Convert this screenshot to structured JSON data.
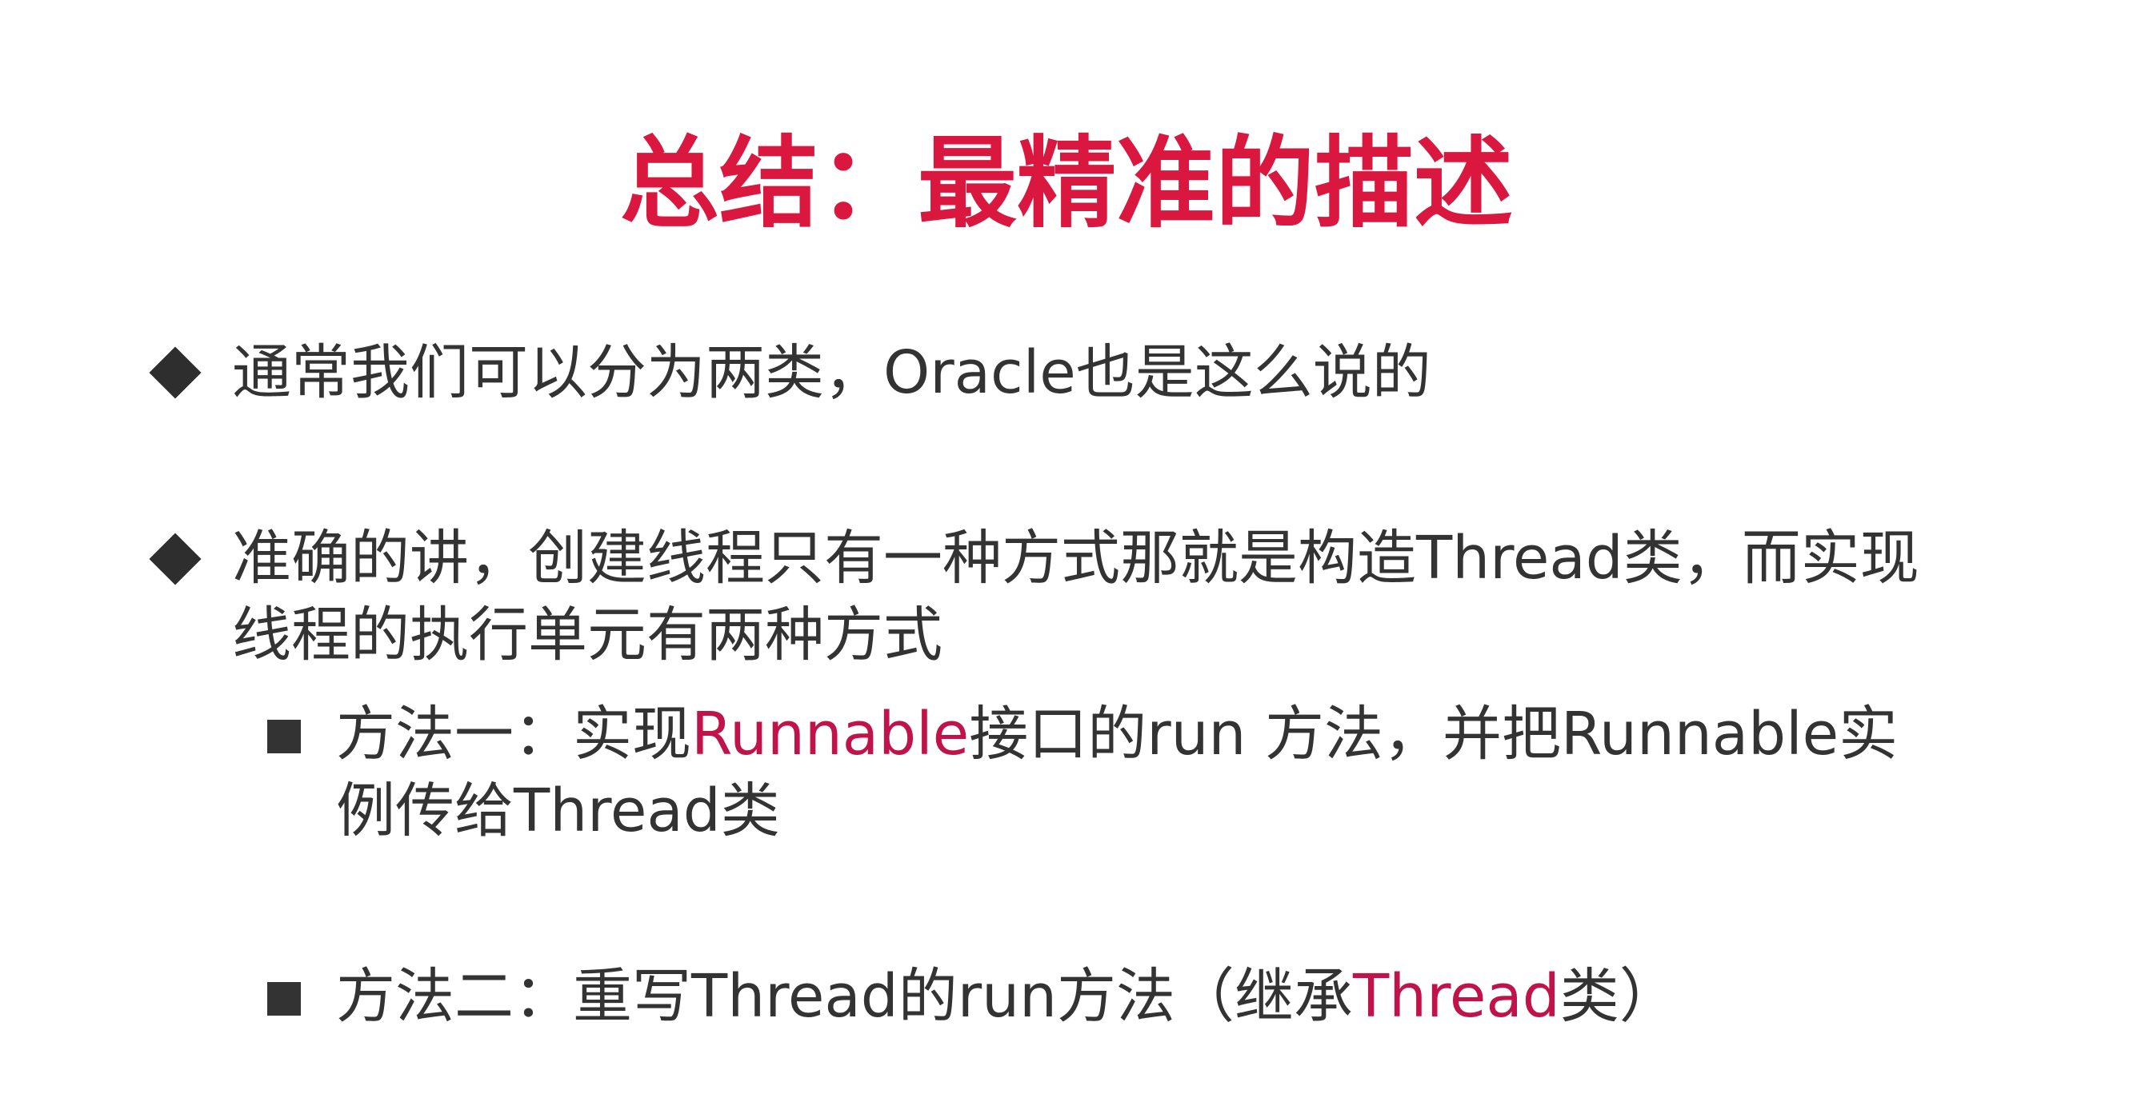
{
  "title": "总结：最精准的描述",
  "bullets": [
    {
      "text": "通常我们可以分为两类，Oracle也是这么说的"
    },
    {
      "line1": "准确的讲，创建线程只有一种方式那就是构造Thread类，而实现",
      "line2": "线程的执行单元有两种方式"
    }
  ],
  "sub_bullets": [
    {
      "prefix": "方法一：实现",
      "highlight": "Runnable",
      "suffix": "接口的run 方法，并把Runnable实",
      "line2": "例传给Thread类"
    },
    {
      "prefix": "方法二：重写Thread的run方法（继承",
      "highlight": "Thread",
      "suffix": "类）"
    }
  ],
  "colors": {
    "title": "#d9173f",
    "highlight": "#c0134a",
    "body_text": "#333333"
  }
}
